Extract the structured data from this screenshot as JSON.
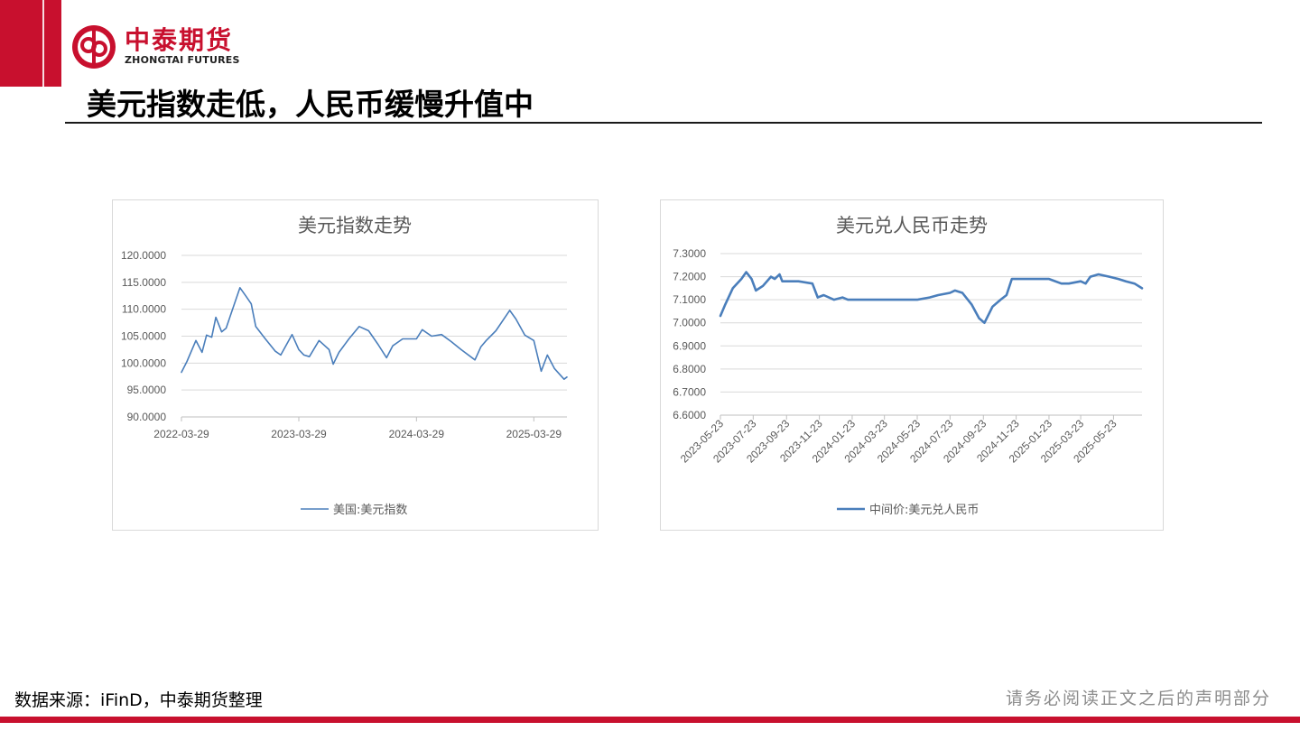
{
  "header": {
    "logo_cn": "中泰期货",
    "logo_en": "ZHONGTAI FUTURES",
    "page_title": "美元指数走低，人民币缓慢升值中"
  },
  "footer": {
    "source": "数据来源：iFinD，中泰期货整理",
    "disclaimer": "请务必阅读正文之后的声明部分"
  },
  "colors": {
    "brand_red": "#c8102e",
    "series_blue": "#4a7ebb",
    "grid": "#d9d9d9",
    "axis_text": "#595959"
  },
  "chart_data": [
    {
      "type": "line",
      "title": "美元指数走势",
      "ylim": [
        90,
        120
      ],
      "y_ticks": [
        "120.0000",
        "115.0000",
        "110.0000",
        "105.0000",
        "100.0000",
        "95.0000",
        "90.0000"
      ],
      "x_ticks": [
        "2022-03-29",
        "2023-03-29",
        "2024-03-29",
        "2025-03-29"
      ],
      "grid": true,
      "legend_position": "bottom",
      "series": [
        {
          "name": "美国:美元指数",
          "x": [
            "2022-03-29",
            "2022-04-15",
            "2022-05-13",
            "2022-06-01",
            "2022-06-15",
            "2022-07-01",
            "2022-07-14",
            "2022-08-01",
            "2022-08-15",
            "2022-09-01",
            "2022-09-27",
            "2022-10-15",
            "2022-11-01",
            "2022-11-15",
            "2022-12-15",
            "2023-01-15",
            "2023-02-01",
            "2023-03-08",
            "2023-03-29",
            "2023-04-14",
            "2023-05-01",
            "2023-05-31",
            "2023-07-01",
            "2023-07-14",
            "2023-08-01",
            "2023-09-01",
            "2023-10-03",
            "2023-11-01",
            "2023-12-01",
            "2023-12-27",
            "2024-01-15",
            "2024-02-15",
            "2024-03-29",
            "2024-04-16",
            "2024-05-15",
            "2024-06-15",
            "2024-07-15",
            "2024-08-15",
            "2024-09-27",
            "2024-10-15",
            "2024-11-01",
            "2024-12-01",
            "2025-01-13",
            "2025-02-01",
            "2025-03-01",
            "2025-03-29",
            "2025-04-21",
            "2025-05-10",
            "2025-06-01",
            "2025-07-01",
            "2025-07-10"
          ],
          "y": [
            98.3,
            100.3,
            104.2,
            102.0,
            105.2,
            104.8,
            108.5,
            105.8,
            106.5,
            109.5,
            114.0,
            112.5,
            111.0,
            106.8,
            104.5,
            102.2,
            101.5,
            105.3,
            102.5,
            101.5,
            101.2,
            104.2,
            102.5,
            99.8,
            102.0,
            104.5,
            106.8,
            106.0,
            103.4,
            101.0,
            103.2,
            104.5,
            104.5,
            106.2,
            105.0,
            105.3,
            104.0,
            102.5,
            100.6,
            103.0,
            104.2,
            106.0,
            109.8,
            108.2,
            105.2,
            104.2,
            98.5,
            101.5,
            99.0,
            97.0,
            97.4
          ]
        }
      ]
    },
    {
      "type": "line",
      "title": "美元兑人民币走势",
      "ylim": [
        6.6,
        7.3
      ],
      "y_ticks": [
        "7.3000",
        "7.2000",
        "7.1000",
        "7.0000",
        "6.9000",
        "6.8000",
        "6.7000",
        "6.6000"
      ],
      "x_ticks": [
        "2023-05-23",
        "2023-07-23",
        "2023-09-23",
        "2023-11-23",
        "2024-01-23",
        "2024-03-23",
        "2024-05-23",
        "2024-07-23",
        "2024-09-23",
        "2024-11-23",
        "2025-01-23",
        "2025-03-23",
        "2025-05-23"
      ],
      "grid": true,
      "legend_position": "bottom",
      "series": [
        {
          "name": "中间价:美元兑人民币",
          "x": [
            "2023-05-23",
            "2023-06-01",
            "2023-06-15",
            "2023-07-01",
            "2023-07-10",
            "2023-07-20",
            "2023-07-28",
            "2023-08-10",
            "2023-08-25",
            "2023-09-01",
            "2023-09-10",
            "2023-09-15",
            "2023-09-22",
            "2023-10-15",
            "2023-11-10",
            "2023-11-20",
            "2023-12-01",
            "2023-12-20",
            "2024-01-05",
            "2024-01-15",
            "2024-02-15",
            "2024-03-15",
            "2024-04-15",
            "2024-05-23",
            "2024-06-15",
            "2024-07-01",
            "2024-07-23",
            "2024-08-01",
            "2024-08-15",
            "2024-09-01",
            "2024-09-15",
            "2024-09-25",
            "2024-10-10",
            "2024-10-25",
            "2024-11-05",
            "2024-11-15",
            "2024-12-01",
            "2025-01-01",
            "2025-01-23",
            "2025-02-15",
            "2025-03-01",
            "2025-03-23",
            "2025-04-01",
            "2025-04-10",
            "2025-04-25",
            "2025-05-15",
            "2025-06-01",
            "2025-06-15",
            "2025-07-01",
            "2025-07-15"
          ],
          "y": [
            7.03,
            7.08,
            7.15,
            7.19,
            7.22,
            7.19,
            7.14,
            7.16,
            7.2,
            7.19,
            7.21,
            7.18,
            7.18,
            7.18,
            7.17,
            7.11,
            7.12,
            7.1,
            7.11,
            7.1,
            7.1,
            7.1,
            7.1,
            7.1,
            7.11,
            7.12,
            7.13,
            7.14,
            7.13,
            7.08,
            7.02,
            7.0,
            7.07,
            7.1,
            7.12,
            7.19,
            7.19,
            7.19,
            7.19,
            7.17,
            7.17,
            7.18,
            7.17,
            7.2,
            7.21,
            7.2,
            7.19,
            7.18,
            7.17,
            7.15
          ]
        }
      ]
    }
  ]
}
